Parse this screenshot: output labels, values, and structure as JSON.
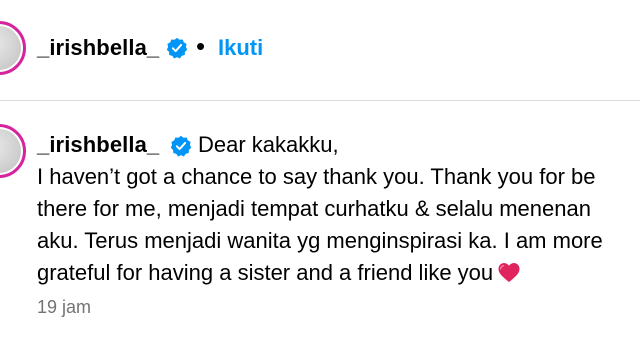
{
  "post": {
    "username": "_irishbella_",
    "dot": "•",
    "follow_label": "Ikuti"
  },
  "comment": {
    "username": "_irishbella_",
    "first_line": "Dear kakakku,",
    "lines": [
      "I haven’t got a chance to say thank you. Thank you for be",
      "there for me, menjadi tempat curhatku & selalu menenan",
      "aku. Terus menjadi wanita yg menginspirasi ka. I am more",
      "grateful for having a sister and a friend like you"
    ],
    "emoji": "heart",
    "timestamp": "19 jam"
  },
  "colors": {
    "accent_blue": "#0095f6",
    "verified_blue": "#0095f6",
    "muted_text": "#737373",
    "divider": "#dbdbdb",
    "heart_red": "#e0245e",
    "avatar_ring": "#d6249f"
  },
  "icons": {
    "verified": "verified-badge-icon",
    "emoji": "red-heart-emoji-icon"
  }
}
